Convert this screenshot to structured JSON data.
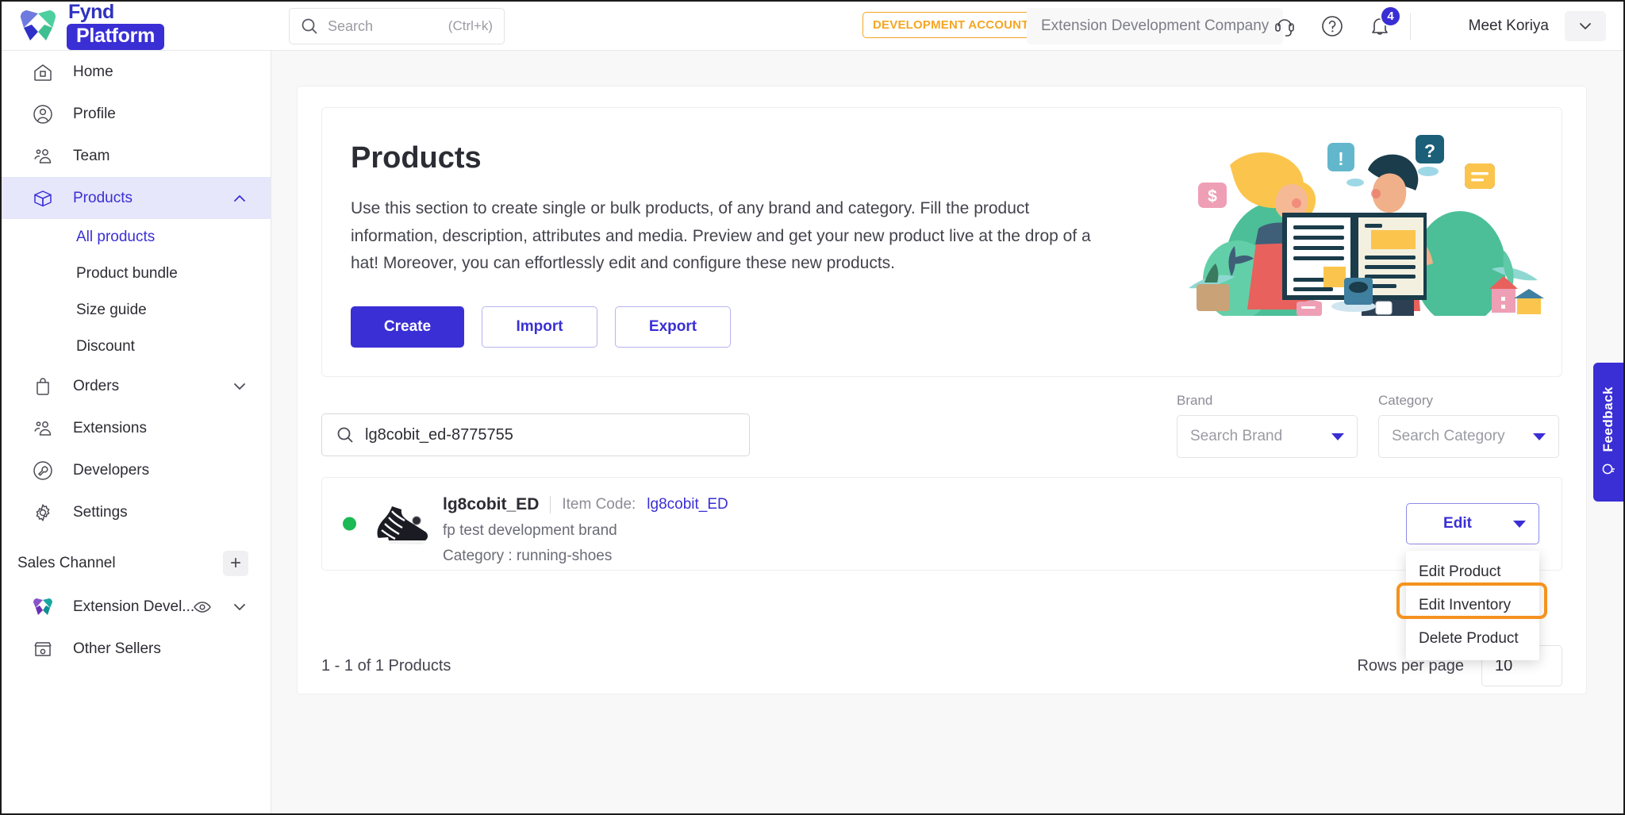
{
  "brand": {
    "logo_top": "Fynd",
    "logo_bottom": "Platform"
  },
  "header": {
    "search_placeholder": "Search",
    "search_shortcut": "(Ctrl+k)",
    "dev_badge": "DEVELOPMENT ACCOUNT",
    "company": "Extension Development Company",
    "notification_count": "4",
    "user_name": "Meet Koriya",
    "icons": [
      "support-headset-icon",
      "help-question-icon",
      "notification-bell-icon",
      "chevron-down-icon"
    ]
  },
  "sidebar": {
    "items": [
      {
        "label": "Home",
        "icon": "home-icon"
      },
      {
        "label": "Profile",
        "icon": "profile-icon"
      },
      {
        "label": "Team",
        "icon": "team-icon"
      },
      {
        "label": "Products",
        "icon": "products-box-icon",
        "expanded": true
      }
    ],
    "product_subitems": [
      {
        "label": "All products",
        "active": true
      },
      {
        "label": "Product bundle",
        "active": false
      },
      {
        "label": "Size guide",
        "active": false
      },
      {
        "label": "Discount",
        "active": false
      }
    ],
    "items_lower": [
      {
        "label": "Orders",
        "icon": "orders-bag-icon"
      },
      {
        "label": "Extensions",
        "icon": "extensions-people-icon"
      },
      {
        "label": "Developers",
        "icon": "developers-wrench-icon"
      },
      {
        "label": "Settings",
        "icon": "settings-gear-icon"
      }
    ],
    "sales_channel_title": "Sales Channel",
    "sales_channel_add": "+",
    "channels": [
      {
        "label": "Extension Devel...",
        "icon": "fynd-heart-icon"
      },
      {
        "label": "Other Sellers",
        "icon": "store-icon"
      }
    ]
  },
  "hero": {
    "title": "Products",
    "description": "Use this section to create single or bulk products, of any brand and category. Fill the product information, description, attributes and media. Preview and get your new product live at the drop of a hat! Moreover, you can effortlessly edit and configure these new products.",
    "buttons": [
      {
        "label": "Create",
        "style": "primary"
      },
      {
        "label": "Import",
        "style": "outline"
      },
      {
        "label": "Export",
        "style": "outline"
      }
    ]
  },
  "filters": {
    "search_value": "lg8cobit_ed-8775755",
    "brand_label": "Brand",
    "brand_placeholder": "Search Brand",
    "category_label": "Category",
    "category_placeholder": "Search Category"
  },
  "product": {
    "name": "lg8cobit_ED",
    "item_code_label": "Item Code:",
    "item_code_value": "lg8cobit_ED",
    "brand": "fp test development brand",
    "category": "Category : running-shoes",
    "status": "active",
    "edit_label": "Edit"
  },
  "dropdown": {
    "items": [
      {
        "label": "Edit Product",
        "highlighted": false
      },
      {
        "label": "Edit Inventory",
        "highlighted": true
      },
      {
        "label": "Delete Product",
        "highlighted": false
      }
    ]
  },
  "table_footer": {
    "count": "1 - 1 of 1 Products",
    "rows_per_page_label": "Rows per page",
    "rows_per_page_value": "10"
  },
  "feedback": {
    "label": "Feedback",
    "icon": "lightbulb-icon"
  },
  "colors": {
    "primary": "#3a2fd4",
    "accent_orange": "#f5921e",
    "status_green": "#1db954",
    "dev_badge": "#f5a623"
  }
}
